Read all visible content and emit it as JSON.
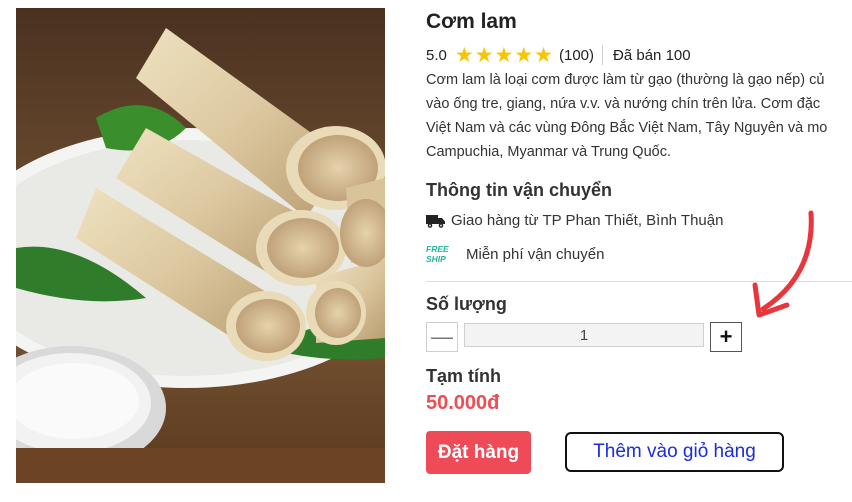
{
  "product": {
    "title": "Cơm lam",
    "rating": "5.0",
    "stars": 5,
    "review_count": "(100)",
    "sold": "Đã bán 100",
    "description_lines": [
      "Cơm lam là loại cơm được làm từ gạo (thường là gạo nếp) củ",
      "vào ống tre, giang, nứa v.v. và nướng chín trên lửa. Cơm đặc",
      "Việt Nam và các vùng Đông Bắc Việt Nam, Tây Nguyên và mo",
      "Campuchia, Myanmar và Trung Quốc."
    ]
  },
  "shipping": {
    "title": "Thông tin vận chuyển",
    "from": "Giao hàng từ TP Phan Thiết, Bình Thuận",
    "freeship_badge_top": "FREE",
    "freeship_badge_bottom": "SHIP",
    "freeship": "Miễn phí vận chuyển"
  },
  "quantity": {
    "title": "Số lượng",
    "minus_label": "—",
    "plus_label": "+",
    "value": "1"
  },
  "subtotal": {
    "title": "Tạm tính",
    "value": "50.000đ"
  },
  "actions": {
    "order_label": "Đặt hàng",
    "add_to_cart_label": "Thêm vào giỏ hàng"
  },
  "colors": {
    "star": "#f7c600",
    "price": "#ee4d55",
    "order_button": "#ef4a57",
    "cart_text": "#1a2be0",
    "freeship": "#1fb59a",
    "annotation_arrow": "#e8363d"
  }
}
